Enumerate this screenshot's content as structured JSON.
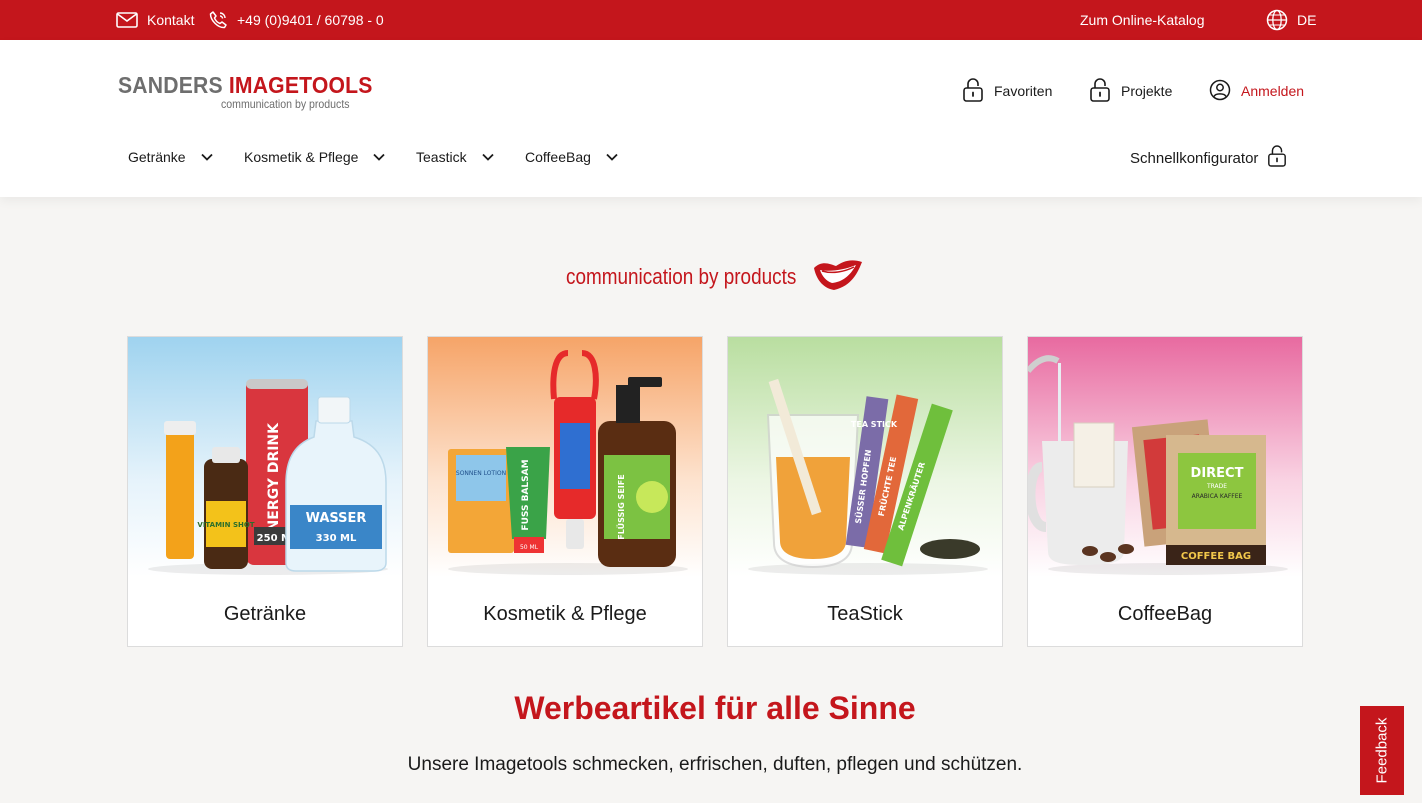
{
  "topbar": {
    "contact": "Kontakt",
    "phone": "+49 (0)9401 / 60798 - 0",
    "catalog": "Zum Online-Katalog",
    "language": "DE"
  },
  "logo": {
    "part1": "SANDERS",
    "part2": "IMAGETOOLS",
    "tagline": "communication by products"
  },
  "header": {
    "favorites": "Favoriten",
    "projects": "Projekte",
    "login": "Anmelden"
  },
  "nav": {
    "items": [
      {
        "label": "Getränke"
      },
      {
        "label": "Kosmetik & Pflege"
      },
      {
        "label": "Teastick"
      },
      {
        "label": "CoffeeBag"
      }
    ],
    "quick_config": "Schnellkonfigurator"
  },
  "hero": {
    "tagline": "communication by products"
  },
  "categories": [
    {
      "label": "Getränke",
      "product_texts": [
        "VITAMIN SHOT",
        "ENERGY DRINK",
        "250 ML",
        "WASSER",
        "330 ML"
      ]
    },
    {
      "label": "Kosmetik & Pflege",
      "product_texts": [
        "SONNEN LOTION",
        "FUSS BALSAM",
        "50 ML",
        "FLÜSSIG SEIFE"
      ]
    },
    {
      "label": "TeaStick",
      "product_texts": [
        "TEA STICK",
        "SÜSSER HOPFEN",
        "FRÜCHTE TEE",
        "ALPENKRÄUTER"
      ]
    },
    {
      "label": "CoffeeBag",
      "product_texts": [
        "DIRECT",
        "TRADE",
        "ARABICA KAFFEE",
        "COFFEE BAG"
      ]
    }
  ],
  "main": {
    "headline": "Werbeartikel für alle Sinne",
    "subline": "Unsere Imagetools schmecken, erfrischen, duften, pflegen und schützen."
  },
  "feedback": "Feedback",
  "colors": {
    "brand_red": "#c4161c",
    "background": "#f6f5f3"
  }
}
